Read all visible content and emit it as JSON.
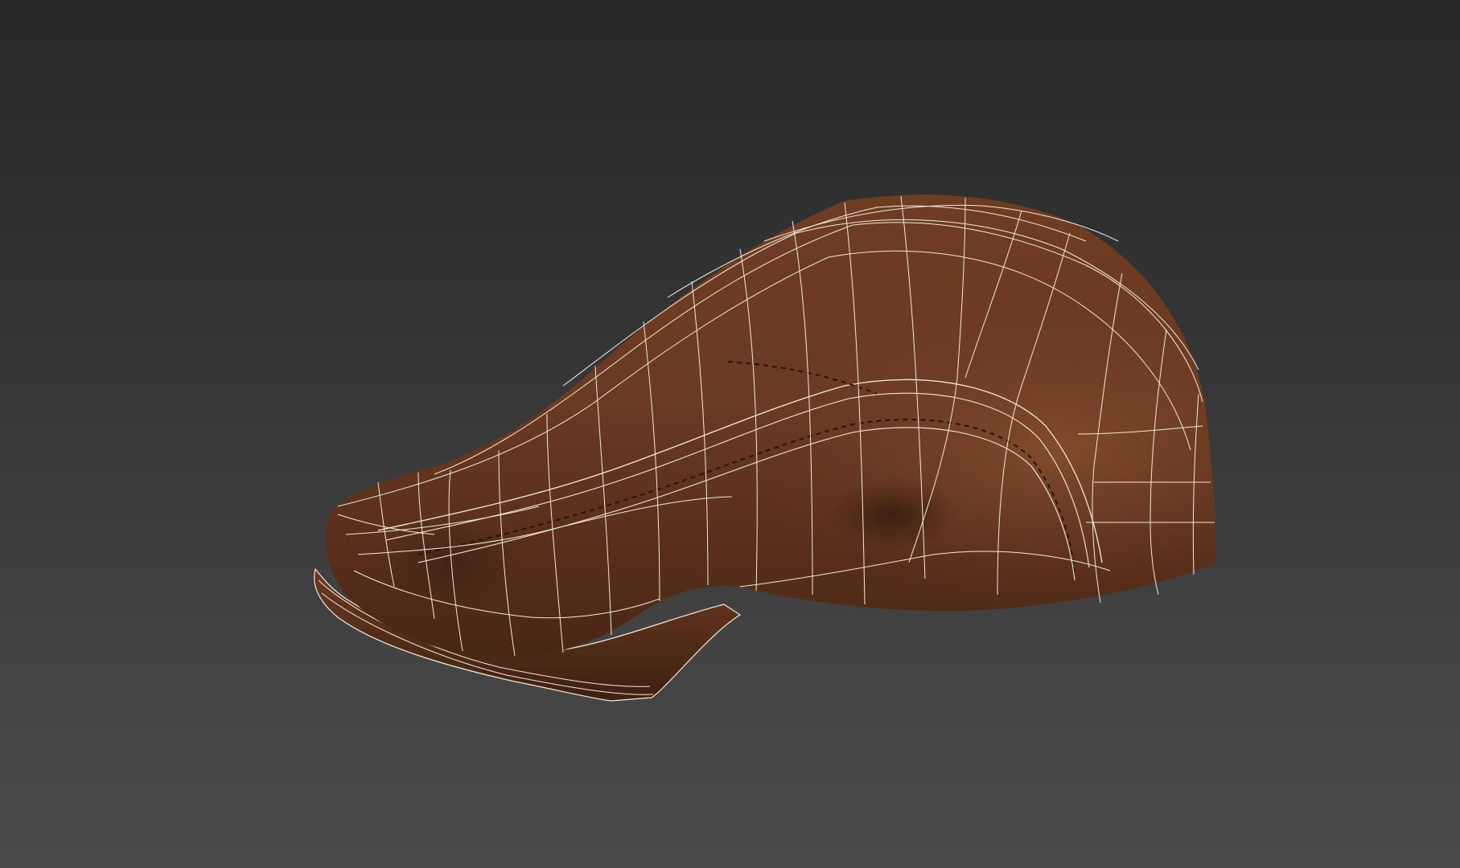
{
  "viewport": {
    "name": "perspective-viewport",
    "background_top": "#282828",
    "background_bottom": "#4a4a4a"
  },
  "model": {
    "object": "flat-cap",
    "material_color": "#6a3a22",
    "material_highlight": "#8a5030",
    "material_shadow": "#3e2012",
    "wireframe_color": "#f4ead8",
    "display_mode": "shaded-with-wireframe"
  }
}
